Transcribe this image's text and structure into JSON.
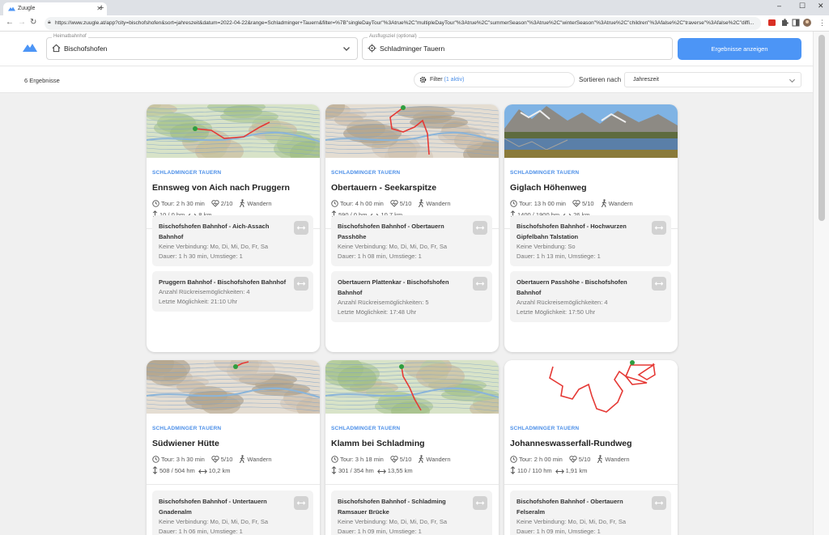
{
  "browser": {
    "tab_title": "Zuugle",
    "url": "https://www.zuugle.at/app?city=bischofshofen&sort=jahreszeit&datum=2022-04-22&range=Schladminger+Tauern&filter=%7B\"singleDayTour\"%3Atrue%2C\"multipleDayTour\"%3Atrue%2C\"summerSeason\"%3Atrue%2C\"winterSeason\"%3Atrue%2C\"children\"%3Afalse%2C\"traverse\"%3Afalse%2C\"diffi..."
  },
  "header": {
    "home_label": "Heimatbahnhof",
    "home_value": "Bischofshofen",
    "dest_label": "Ausflugsziel (optional)",
    "dest_value": "Schladminger Tauern",
    "cta": "Ergebnisse anzeigen",
    "accent": "#4c95f6"
  },
  "toolbar": {
    "count": "6 Ergebnisse",
    "filter_label": "Filter",
    "filter_active": "(1 aktiv)",
    "sort_label": "Sortieren nach",
    "sort_value": "Jahreszeit"
  },
  "cards": [
    {
      "image": "map-green",
      "region": "SCHLADMINGER TAUERN",
      "title": "Ennsweg von Aich nach Pruggern",
      "tour": "Tour: 2 h 30 min",
      "difficulty": "2/10",
      "type": "Wandern",
      "elevation": "10 / 0 hm",
      "distance": "8 km",
      "connections": [
        {
          "title": "Bischofshofen Bahnhof - Aich-Assach Bahnhof",
          "lines": [
            "Keine Verbindung: Mo, Di, Mi, Do, Fr, Sa",
            "Dauer: 1 h 30 min, Umstiege: 1"
          ]
        },
        {
          "title": "Pruggern Bahnhof - Bischofshofen Bahnhof",
          "lines": [
            "Anzahl Rückreisemöglichkeiten: 4",
            "Letzte Möglichkeit: 21:10 Uhr"
          ]
        }
      ]
    },
    {
      "image": "map-mountain",
      "region": "SCHLADMINGER TAUERN",
      "title": "Obertauern - Seekarspitze",
      "tour": "Tour: 4 h 00 min",
      "difficulty": "5/10",
      "type": "Wandern",
      "elevation": "590 / 0 hm",
      "distance": "10,7 km",
      "connections": [
        {
          "title": "Bischofshofen Bahnhof - Obertauern Passhöhe",
          "lines": [
            "Keine Verbindung: Mo, Di, Mi, Do, Fr, Sa",
            "Dauer: 1 h 08 min, Umstiege: 1"
          ]
        },
        {
          "title": "Obertauern Plattenkar - Bischofshofen Bahnhof",
          "lines": [
            "Anzahl Rückreisemöglichkeiten: 5",
            "Letzte Möglichkeit: 17:48 Uhr"
          ]
        }
      ]
    },
    {
      "image": "photo-lake",
      "region": "SCHLADMINGER TAUERN",
      "title": "Giglach Höhenweg",
      "tour": "Tour: 13 h 00 min",
      "difficulty": "5/10",
      "type": "Wandern",
      "elevation": "1400 / 1900 hm",
      "distance": "26 km",
      "connections": [
        {
          "title": "Bischofshofen Bahnhof - Hochwurzen Gipfelbahn Talstation",
          "lines": [
            "Keine Verbindung: So",
            "Dauer: 1 h 13 min, Umstiege: 1"
          ]
        },
        {
          "title": "Obertauern Passhöhe - Bischofshofen Bahnhof",
          "lines": [
            "Anzahl Rückreisemöglichkeiten: 4",
            "Letzte Möglichkeit: 17:50 Uhr"
          ]
        }
      ]
    },
    {
      "image": "map-mountain",
      "region": "SCHLADMINGER TAUERN",
      "title": "Südwiener Hütte",
      "tour": "Tour: 3 h 30 min",
      "difficulty": "5/10",
      "type": "Wandern",
      "elevation": "508 / 504 hm",
      "distance": "10,2 km",
      "connections": [
        {
          "title": "Bischofshofen Bahnhof - Untertauern Gnadenalm",
          "lines": [
            "Keine Verbindung: Mo, Di, Mi, Do, Fr, Sa",
            "Dauer: 1 h 06 min, Umstiege: 1"
          ]
        }
      ]
    },
    {
      "image": "map-green",
      "region": "SCHLADMINGER TAUERN",
      "title": "Klamm bei Schladming",
      "tour": "Tour: 3 h 18 min",
      "difficulty": "5/10",
      "type": "Wandern",
      "elevation": "301 / 354 hm",
      "distance": "13,55 km",
      "connections": [
        {
          "title": "Bischofshofen Bahnhof - Schladming Ramsauer Brücke",
          "lines": [
            "Keine Verbindung: Mo, Di, Mi, Do, Fr, Sa",
            "Dauer: 1 h 09 min, Umstiege: 1"
          ]
        }
      ]
    },
    {
      "image": "route-only",
      "region": "SCHLADMINGER TAUERN",
      "title": "Johanneswasserfall-Rundweg",
      "tour": "Tour: 2 h 00 min",
      "difficulty": "5/10",
      "type": "Wandern",
      "elevation": "110 / 110 hm",
      "distance": "1,91 km",
      "connections": [
        {
          "title": "Bischofshofen Bahnhof - Obertauern Felseralm",
          "lines": [
            "Keine Verbindung: Mo, Di, Mi, Do, Fr, Sa",
            "Dauer: 1 h 09 min, Umstiege: 1"
          ]
        }
      ]
    }
  ]
}
